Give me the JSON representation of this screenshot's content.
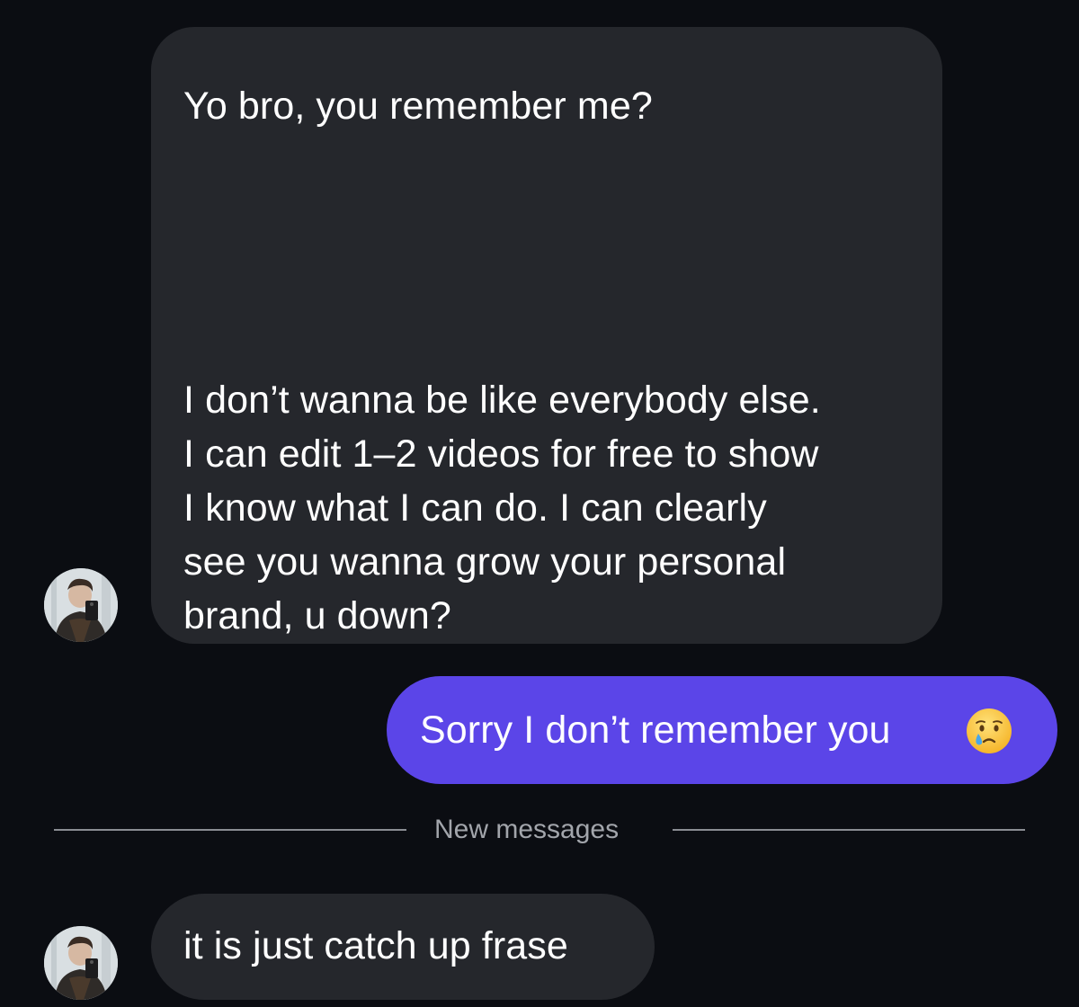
{
  "conversation": {
    "messages": [
      {
        "sender": "contact",
        "lines": [
          "Yo bro, you remember me?",
          "I don’t wanna be like everybody else.",
          "I can edit 1–2 videos for free to show",
          "I know what I can do. I can clearly",
          "see you wanna grow your personal",
          "brand, u down?"
        ]
      },
      {
        "sender": "self",
        "text": "Sorry I don’t remember you",
        "emoji": "crying-face-icon"
      },
      {
        "sender": "contact",
        "text": "it is just catch up frase"
      }
    ],
    "new_messages_divider": "New messages"
  },
  "colors": {
    "background": "#0b0d12",
    "incoming_bubble": "#25272c",
    "outgoing_bubble": "#5b45e8",
    "divider": "#8a8d93"
  }
}
